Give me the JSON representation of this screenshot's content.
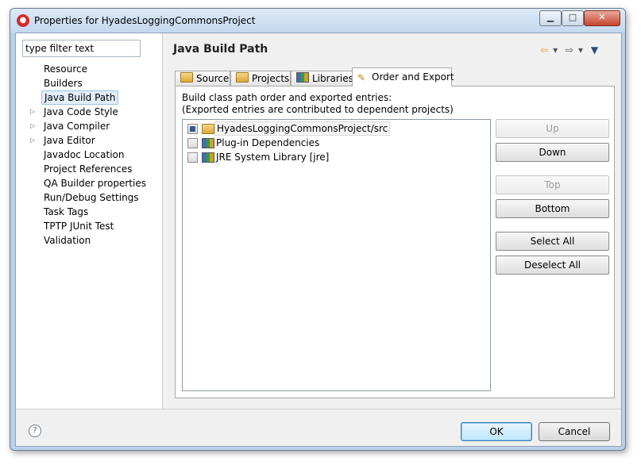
{
  "window": {
    "title": "Properties for HyadesLoggingCommonsProject"
  },
  "nav": {
    "filter_value": "type filter text",
    "items": [
      {
        "label": "Resource",
        "expandable": false
      },
      {
        "label": "Builders",
        "expandable": false
      },
      {
        "label": "Java Build Path",
        "expandable": false,
        "selected": true
      },
      {
        "label": "Java Code Style",
        "expandable": true
      },
      {
        "label": "Java Compiler",
        "expandable": true
      },
      {
        "label": "Java Editor",
        "expandable": true
      },
      {
        "label": "Javadoc Location",
        "expandable": false
      },
      {
        "label": "Project References",
        "expandable": false
      },
      {
        "label": "QA Builder properties",
        "expandable": false
      },
      {
        "label": "Run/Debug Settings",
        "expandable": false
      },
      {
        "label": "Task Tags",
        "expandable": false
      },
      {
        "label": "TPTP JUnit Test",
        "expandable": false
      },
      {
        "label": "Validation",
        "expandable": false
      }
    ]
  },
  "pane": {
    "title": "Java Build Path",
    "tabs": [
      {
        "label": "Source",
        "icon": "source-folder-icon"
      },
      {
        "label": "Projects",
        "icon": "projects-folder-icon"
      },
      {
        "label": "Libraries",
        "icon": "libraries-icon"
      },
      {
        "label": "Order and Export",
        "icon": "order-export-icon",
        "active": true
      }
    ],
    "description_line1": "Build class path order and exported entries:",
    "description_line2": "(Exported entries are contributed to dependent projects)",
    "entries": [
      {
        "label": "HyadesLoggingCommonsProject/src",
        "checked": true,
        "icon": "package-folder-icon",
        "selected": true
      },
      {
        "label": "Plug-in Dependencies",
        "checked": false,
        "icon": "library-icon"
      },
      {
        "label": "JRE System Library [jre]",
        "checked": false,
        "icon": "library-icon"
      }
    ],
    "buttons": {
      "up": "Up",
      "down": "Down",
      "top": "Top",
      "bottom": "Bottom",
      "select_all": "Select All",
      "deselect_all": "Deselect All"
    }
  },
  "footer": {
    "ok": "OK",
    "cancel": "Cancel"
  },
  "colors": {
    "titlebar": "#c4d8ee",
    "ok_accent": "#3c7fb1"
  }
}
